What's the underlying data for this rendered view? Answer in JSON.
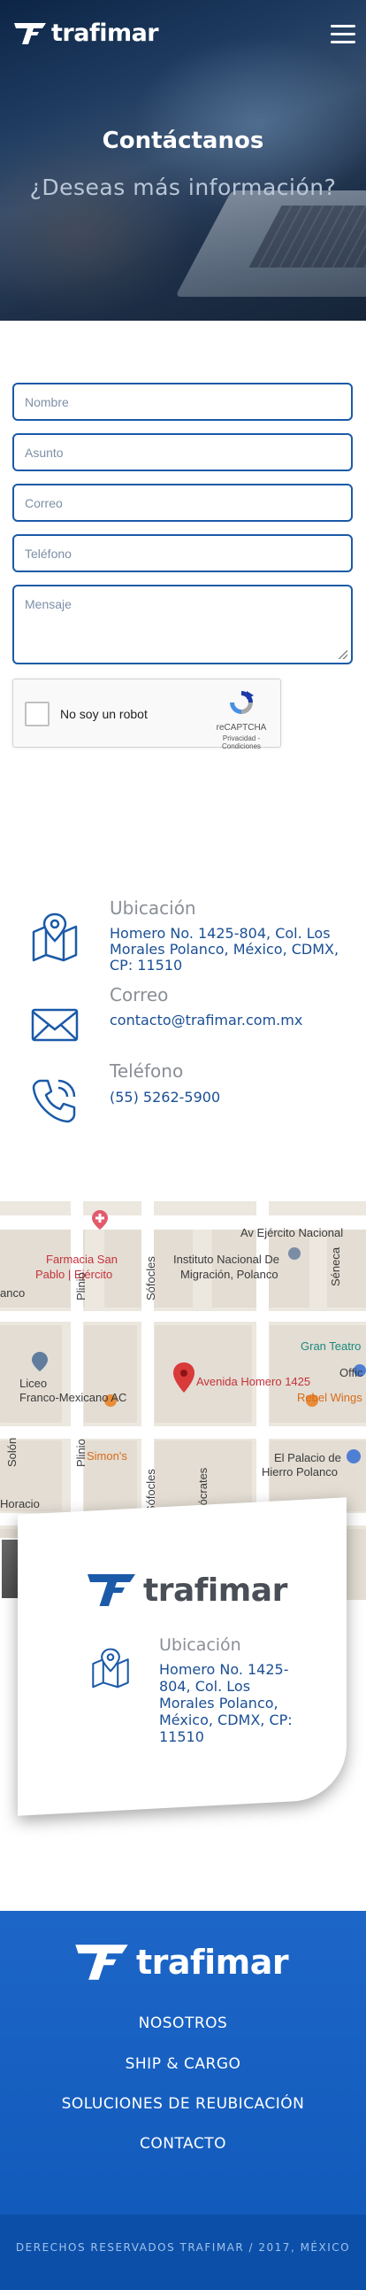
{
  "header": {
    "logo_text": "trafimar",
    "menu_icon": "hamburger-menu-icon"
  },
  "hero": {
    "title": "Contáctanos",
    "subtitle": "¿Deseas más información?"
  },
  "form": {
    "name_placeholder": "Nombre",
    "subject_placeholder": "Asunto",
    "email_placeholder": "Correo",
    "phone_placeholder": "Teléfono",
    "message_placeholder": "Mensaje",
    "captcha": {
      "label": "No soy un robot",
      "brand": "reCAPTCHA",
      "links": "Privacidad - Condiciones"
    }
  },
  "contact": {
    "location_title": "Ubicación",
    "location_text": "Homero No. 1425-804, Col. Los Morales Polanco, México, CDMX, CP: 11510",
    "email_title": "Correo",
    "email_text": "contacto@trafimar.com.mx",
    "phone_title": "Teléfono",
    "phone_text": "(55) 5262-5900"
  },
  "map": {
    "labels": {
      "av_ejercito": "Av Ejército Nacional",
      "farmacia1": "Farmacia San",
      "farmacia2": "Pablo | Ejército",
      "instituto1": "Instituto Nacional De",
      "instituto2": "Migración, Polanco",
      "gran_teatro": "Gran Teatro",
      "offic": "Offic",
      "avenida_homero": "Avenida Homero 1425",
      "rebel_wings": "Rebel Wings",
      "liceo1": "Liceo",
      "liceo2": "Franco-Mexicano AC",
      "simons": "Simon's",
      "palacio1": "El Palacio de",
      "palacio2": "Hierro Polanco",
      "horacio": "Horacio",
      "ranco": "anco",
      "sofocles": "Sófocles",
      "socrates": "Sócrates",
      "plinio": "Plinio",
      "solon": "Solón",
      "seneca": "Séneca"
    },
    "card": {
      "logo_text": "trafimar",
      "location_title": "Ubicación",
      "location_text": "Homero No. 1425-804, Col. Los Morales Polanco, México, CDMX, CP: 11510"
    }
  },
  "footer": {
    "logo_text": "trafimar",
    "links": [
      "NOSOTROS",
      "SHIP & CARGO",
      "SOLUCIONES DE REUBICACIÓN",
      "CONTACTO"
    ],
    "copyright": "DERECHOS RESERVADOS TRAFIMAR / 2017, MÉXICO"
  },
  "colors": {
    "brand_blue": "#1b5aa8",
    "footer_blue": "#1d66c8",
    "map_pin_red": "#d93a3a"
  }
}
